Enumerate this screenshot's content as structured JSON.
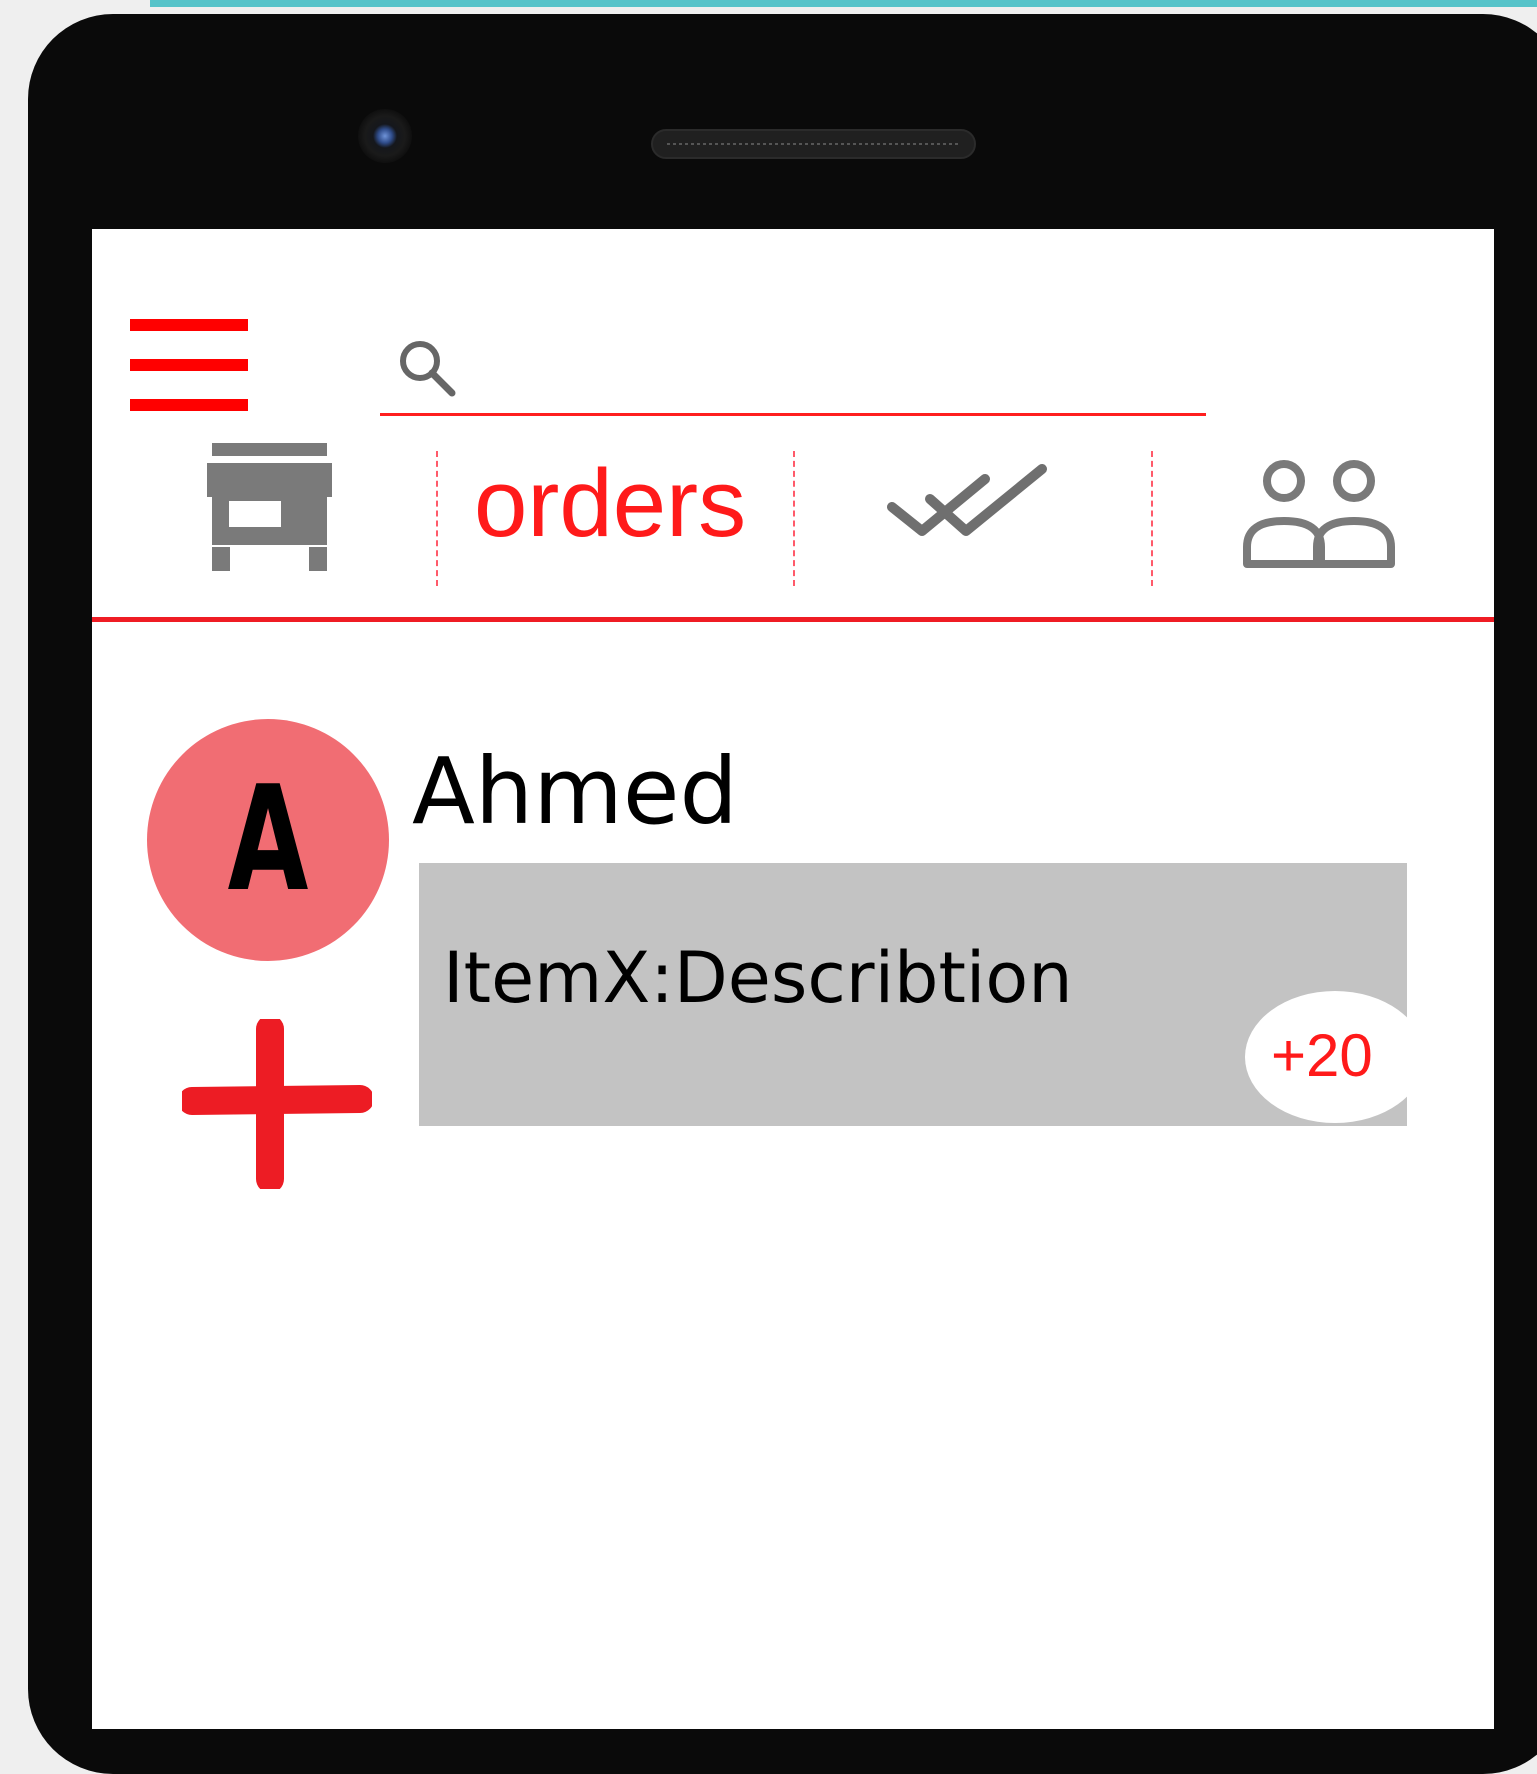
{
  "header": {
    "search": {
      "value": "",
      "placeholder": ""
    }
  },
  "tabs": [
    {
      "label": "",
      "icon": "store-icon"
    },
    {
      "label": "orders",
      "active": true
    },
    {
      "label": "",
      "icon": "double-check-icon"
    },
    {
      "label": "",
      "icon": "users-icon"
    }
  ],
  "order": {
    "avatar_letter": "A",
    "customer_name": "Ahmed",
    "item_text": "ItemX:Describtion",
    "price": "+20"
  },
  "colors": {
    "accent": "#ef1c24",
    "avatar": "#f16d73",
    "card": "#c3c3c3",
    "icon_gray": "#7a7a7a",
    "top_accent": "#56c3c9"
  }
}
